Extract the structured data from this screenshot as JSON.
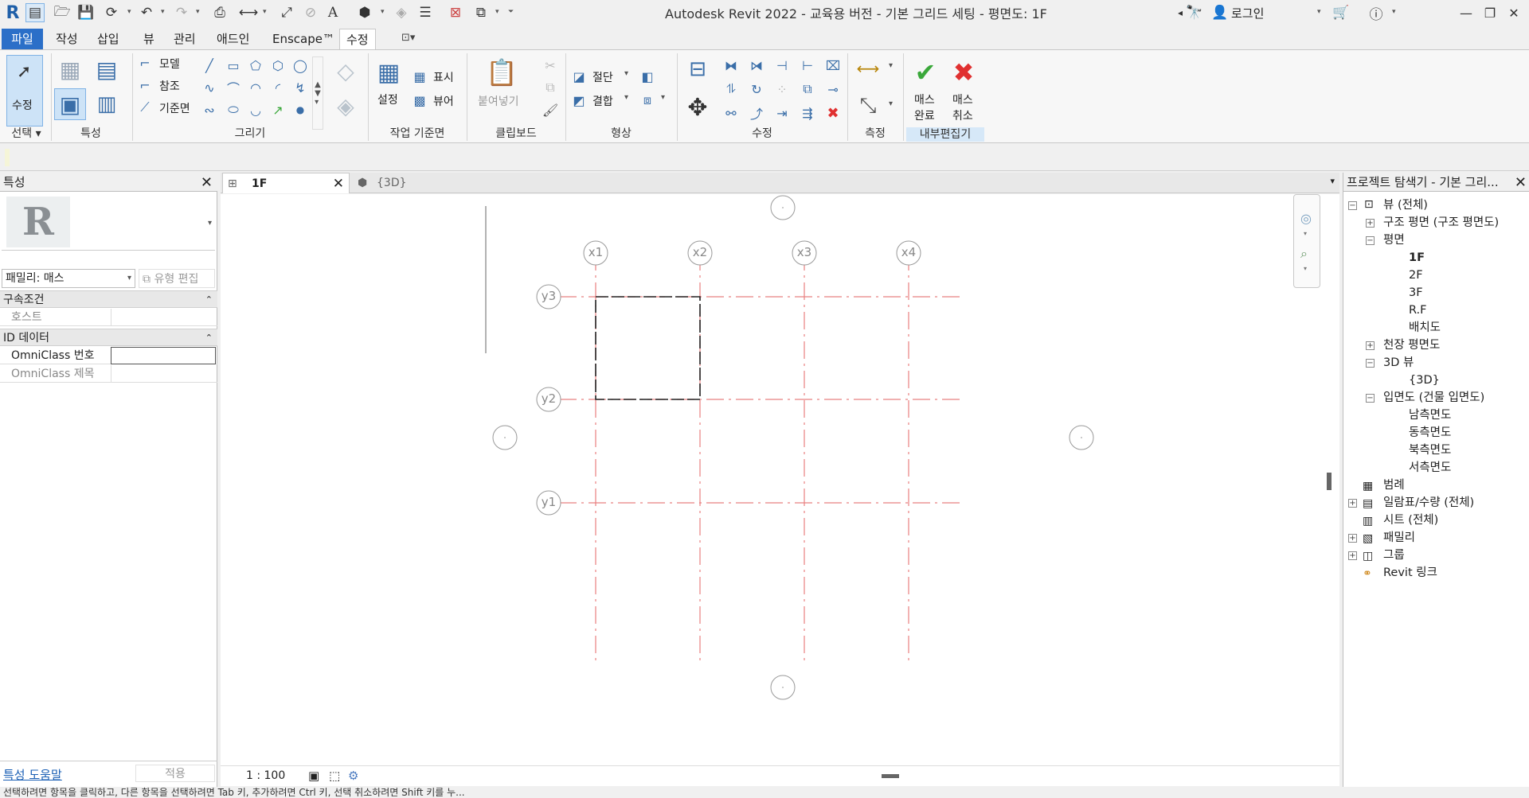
{
  "window": {
    "title": "Autodesk Revit 2022 - 교육용 버전 - 기본 그리드 세팅 - 평면도: 1F",
    "login_label": "로그인"
  },
  "ribbon": {
    "tabs": [
      "파일",
      "작성",
      "삽입",
      "뷰",
      "관리",
      "애드인",
      "Enscape™",
      "수정"
    ],
    "active_tab": "수정",
    "panels": {
      "select": "선택",
      "properties": "특성",
      "draw": "그리기",
      "workplane": "작업 기준면",
      "clipboard": "클립보드",
      "geometry": "형상",
      "modify": "수정",
      "measure": "측정",
      "inplace": "내부편집기"
    },
    "buttons": {
      "modify": "수정",
      "model": "모델",
      "reference": "참조",
      "reference_plane": "기준면",
      "set": "설정",
      "show": "표시",
      "viewer": "뷰어",
      "paste": "붙여넣기",
      "cut": "절단",
      "join": "결합",
      "finish_mass_1": "매스",
      "finish_mass_2": "완료",
      "cancel_mass_1": "매스",
      "cancel_mass_2": "취소"
    }
  },
  "properties": {
    "header": "특성",
    "family_selector": "패밀리: 매스",
    "edit_type": "유형 편집",
    "sections": [
      {
        "title": "구속조건",
        "rows": [
          {
            "label": "호스트",
            "value": ""
          }
        ]
      },
      {
        "title": "ID 데이터",
        "rows": [
          {
            "label": "OmniClass 번호",
            "value": ""
          },
          {
            "label": "OmniClass 제목",
            "value": ""
          }
        ]
      }
    ],
    "help_link": "특성 도움말",
    "apply_button": "적용"
  },
  "view": {
    "tabs": [
      {
        "label": "1F",
        "active": true
      },
      {
        "label": "{3D}",
        "active": false
      }
    ],
    "scale": "1 : 100",
    "grid_labels_x": [
      "x1",
      "x2",
      "x3",
      "x4"
    ],
    "grid_labels_y": [
      "y3",
      "y2",
      "y1"
    ]
  },
  "browser": {
    "header": "프로젝트 탐색기 - 기본 그리...",
    "tree": [
      {
        "label": "뷰 (전체)",
        "level": 0,
        "expander": "−"
      },
      {
        "label": "구조 평면 (구조 평면도)",
        "level": 1,
        "expander": "+"
      },
      {
        "label": "평면",
        "level": 1,
        "expander": "−"
      },
      {
        "label": "1F",
        "level": 2,
        "bold": true
      },
      {
        "label": "2F",
        "level": 2
      },
      {
        "label": "3F",
        "level": 2
      },
      {
        "label": "R.F",
        "level": 2
      },
      {
        "label": "배치도",
        "level": 2
      },
      {
        "label": "천장 평면도",
        "level": 1,
        "expander": "+"
      },
      {
        "label": "3D 뷰",
        "level": 1,
        "expander": "−"
      },
      {
        "label": "{3D}",
        "level": 2
      },
      {
        "label": "입면도 (건물 입면도)",
        "level": 1,
        "expander": "−"
      },
      {
        "label": "남측면도",
        "level": 2
      },
      {
        "label": "동측면도",
        "level": 2
      },
      {
        "label": "북측면도",
        "level": 2
      },
      {
        "label": "서측면도",
        "level": 2
      },
      {
        "label": "범례",
        "level": 0
      },
      {
        "label": "일람표/수량 (전체)",
        "level": 0,
        "expander": "+"
      },
      {
        "label": "시트 (전체)",
        "level": 0
      },
      {
        "label": "패밀리",
        "level": 0,
        "expander": "+"
      },
      {
        "label": "그룹",
        "level": 0,
        "expander": "+"
      },
      {
        "label": "Revit 링크",
        "level": 0
      }
    ]
  },
  "status": {
    "text": "선택하려면 항목을 클릭하고, 다른 항목을 선택하려면 Tab 키, 추가하려면 Ctrl 키, 선택 취소하려면 Shift 키를 누..."
  },
  "colors": {
    "accent": "#2b6fc8",
    "grid_line": "#e88080",
    "finish_green": "#3aa83a",
    "cancel_red": "#e03030"
  }
}
